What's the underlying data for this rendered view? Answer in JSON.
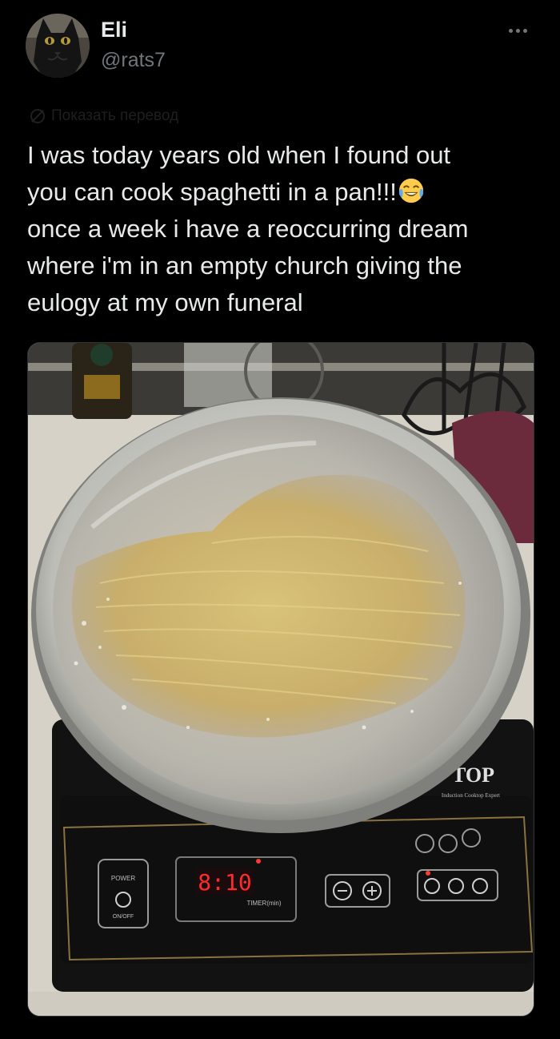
{
  "author": {
    "name": "Eli",
    "handle": "@rats7"
  },
  "tweet": {
    "translate_label": "Показать перевод",
    "lines": [
      "I was today years old when I found out",
      "you can cook spaghetti in a pan!!!",
      "once a week i have a reoccurring dream",
      "where i'm in an empty church giving the",
      "eulogy at my own funeral"
    ],
    "emoji": "face-with-tears-of-joy"
  },
  "photo": {
    "cooktop_brand": "TOP",
    "cooktop_tagline": "Induction Cooktop Expert",
    "display_value": "8:10",
    "power_label": "POWER",
    "onoff_label": "ON/OFF",
    "timer_label": "TIMER(min)"
  },
  "colors": {
    "background": "#000000",
    "text_primary": "#e7e9ea",
    "text_secondary": "#71767b",
    "translate_muted": "#1e1f21"
  }
}
